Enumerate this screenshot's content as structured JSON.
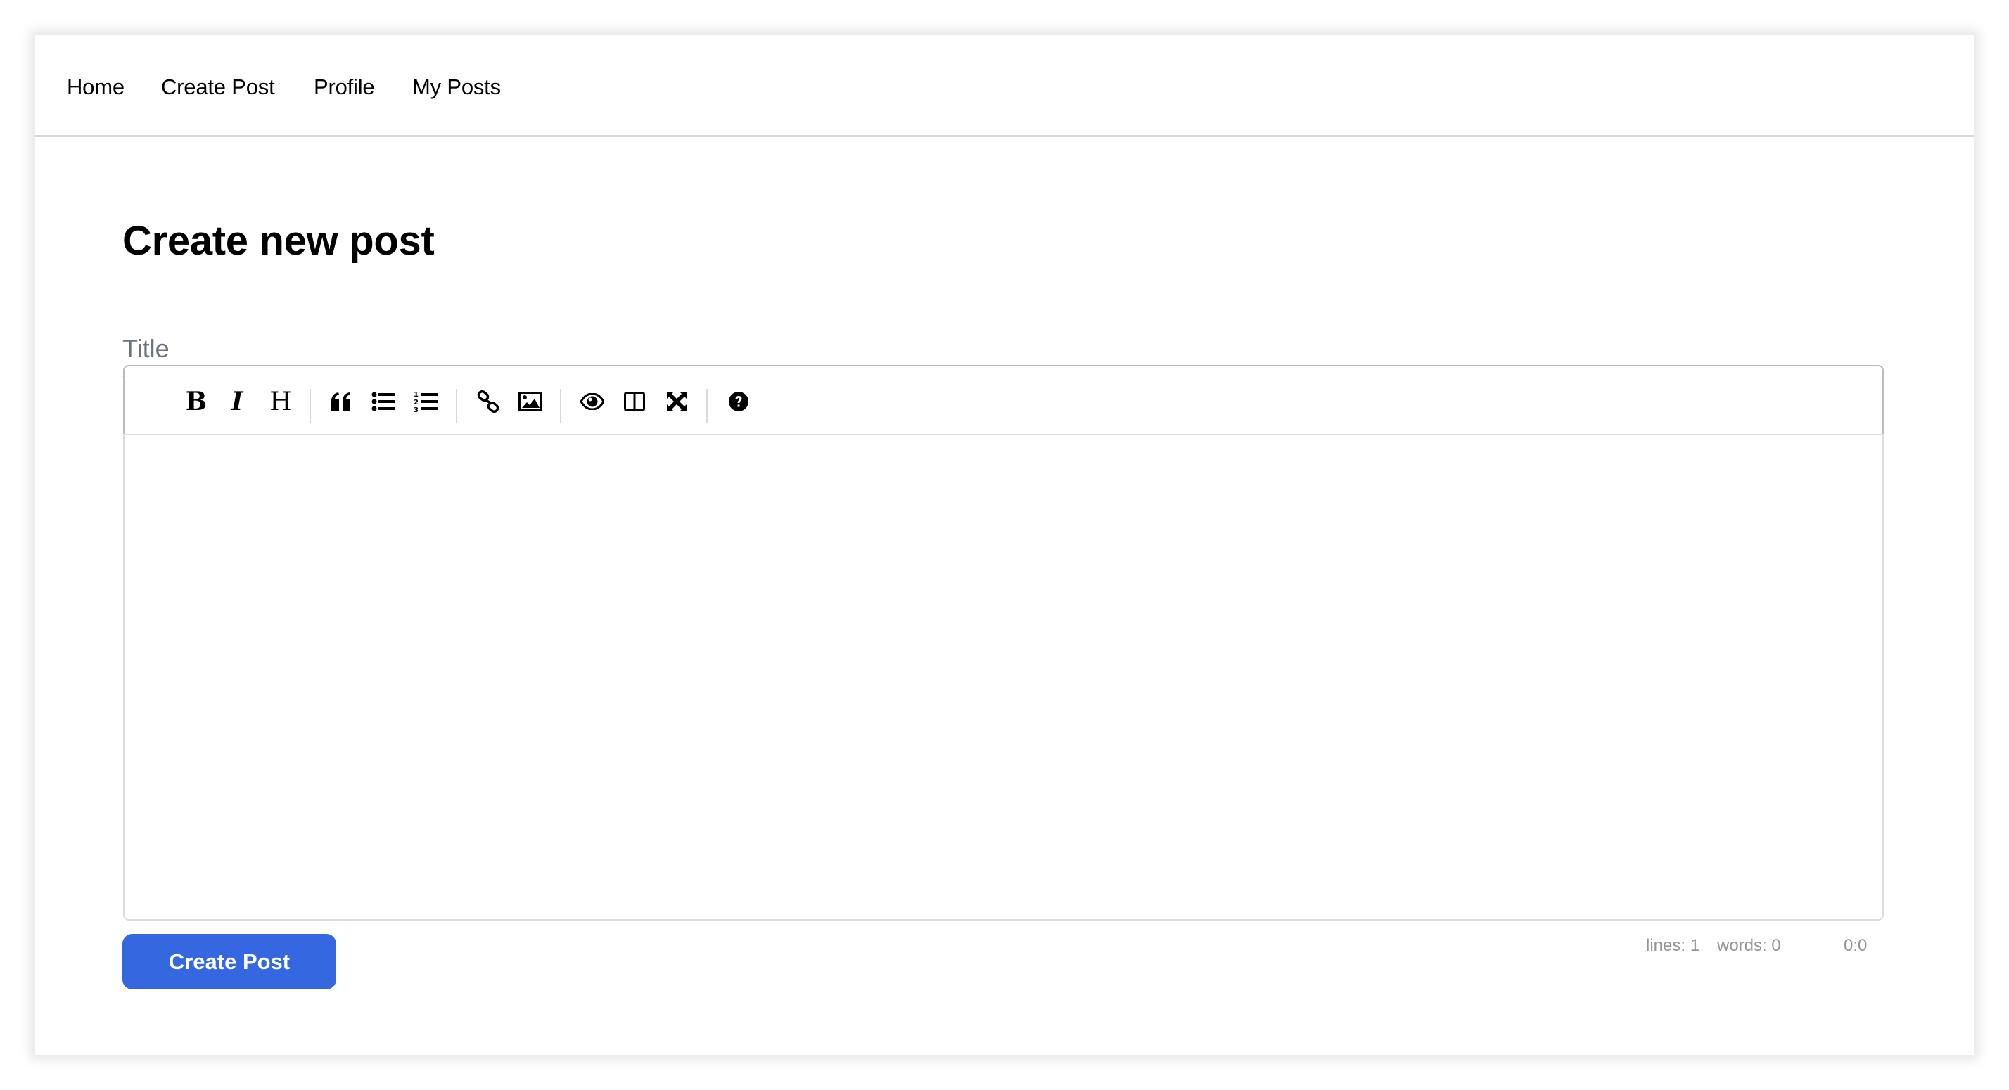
{
  "nav": {
    "items": [
      {
        "label": "Home"
      },
      {
        "label": "Create Post"
      },
      {
        "label": "Profile"
      },
      {
        "label": "My Posts"
      }
    ]
  },
  "main": {
    "heading": "Create new post",
    "title_input": {
      "value": "",
      "placeholder": "Title"
    },
    "editor": {
      "toolbar": [
        {
          "name": "bold",
          "icon": "bold-icon",
          "glyph": "B",
          "title": "Bold"
        },
        {
          "name": "italic",
          "icon": "italic-icon",
          "glyph": "I",
          "title": "Italic"
        },
        {
          "name": "heading",
          "icon": "heading-icon",
          "glyph": "H",
          "title": "Heading"
        },
        {
          "name": "quote",
          "icon": "quote-icon",
          "title": "Quote"
        },
        {
          "name": "unordered-list",
          "icon": "unordered-list-icon",
          "title": "Generic List"
        },
        {
          "name": "ordered-list",
          "icon": "ordered-list-icon",
          "title": "Numbered List"
        },
        {
          "name": "link",
          "icon": "link-icon",
          "title": "Create Link"
        },
        {
          "name": "image",
          "icon": "image-icon",
          "title": "Insert Image"
        },
        {
          "name": "preview",
          "icon": "eye-icon",
          "title": "Toggle Preview"
        },
        {
          "name": "side-by-side",
          "icon": "columns-icon",
          "title": "Toggle Side by Side"
        },
        {
          "name": "fullscreen",
          "icon": "fullscreen-icon",
          "title": "Toggle Fullscreen"
        },
        {
          "name": "guide",
          "icon": "question-circle-icon",
          "title": "Markdown Guide"
        }
      ],
      "content": "",
      "status": {
        "lines": "lines: 1",
        "words": "words: 0",
        "cursor": "0:0"
      }
    },
    "submit_label": "Create Post"
  },
  "colors": {
    "primary_button": "#3467e0",
    "placeholder": "#6b7280",
    "status_text": "#959694"
  }
}
